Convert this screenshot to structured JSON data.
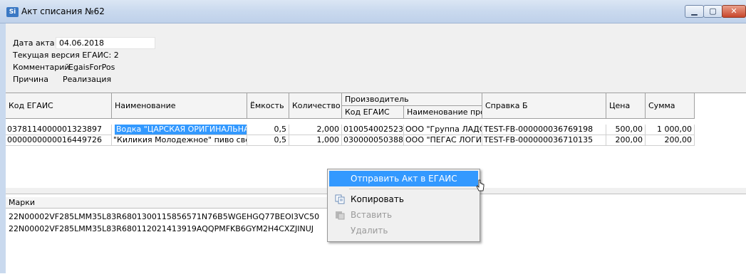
{
  "window": {
    "title": "Акт списания №62",
    "icon_text": "Si"
  },
  "header": {
    "date_label": "Дата акта",
    "date_value": "04.06.2018",
    "version_label": "Текущая версия ЕГАИС: 2",
    "comment_label": "Комментарий",
    "comment_value": "EgaisForPos",
    "reason_label": "Причина",
    "reason_value": "Реализация"
  },
  "table": {
    "headers": {
      "code": "Код ЕГАИС",
      "name": "Наименование",
      "capacity": "Ёмкость",
      "quantity": "Количество",
      "producer": "Производитель",
      "producer_code": "Код ЕГАИС",
      "producer_name": "Наименование производителя",
      "certificate": "Справка Б",
      "price": "Цена",
      "sum": "Сумма"
    },
    "rows": [
      {
        "code": "0378114000001323897",
        "name": "Водка \"ЦАРСКАЯ ОРИГИНАЛЬНАЯ\"",
        "capacity": "0,5",
        "quantity": "2,000",
        "producer_code": "010054002523",
        "producer_name": "ООО \"Группа ЛАДОГА\"",
        "certificate": "TEST-FB-000000036769198",
        "price": "500,00",
        "sum": "1 000,00"
      },
      {
        "code": "0000000000016449726",
        "name": "\"Киликия Молодежное\" пиво светлое",
        "capacity": "0,5",
        "quantity": "1,000",
        "producer_code": "030000050388",
        "producer_name": "ООО \"ПЕГАС ЛОГИСТИК\"",
        "certificate": "TEST-FB-000000036710135",
        "price": "200,00",
        "sum": "200,00"
      }
    ]
  },
  "marks": {
    "header": "Марки",
    "rows": [
      "22N00002VF285LMM35L83R6801300115856571N76B5WGEHGQ77BEOI3VC50",
      "22N00002VF285LMM35L83R680112021413919AQQPMFKB6GYM2H4CXZJINUJ"
    ]
  },
  "context_menu": {
    "items": [
      {
        "label": "Отправить Акт в ЕГАИС",
        "enabled": true,
        "highlighted": true
      },
      {
        "label": "Копировать",
        "enabled": true,
        "icon": "copy-icon"
      },
      {
        "label": "Вставить",
        "enabled": false,
        "icon": "paste-icon"
      },
      {
        "label": "Удалить",
        "enabled": false
      }
    ]
  },
  "colors": {
    "selection": "#3399ff",
    "titlebar": "#c9d9ee"
  }
}
